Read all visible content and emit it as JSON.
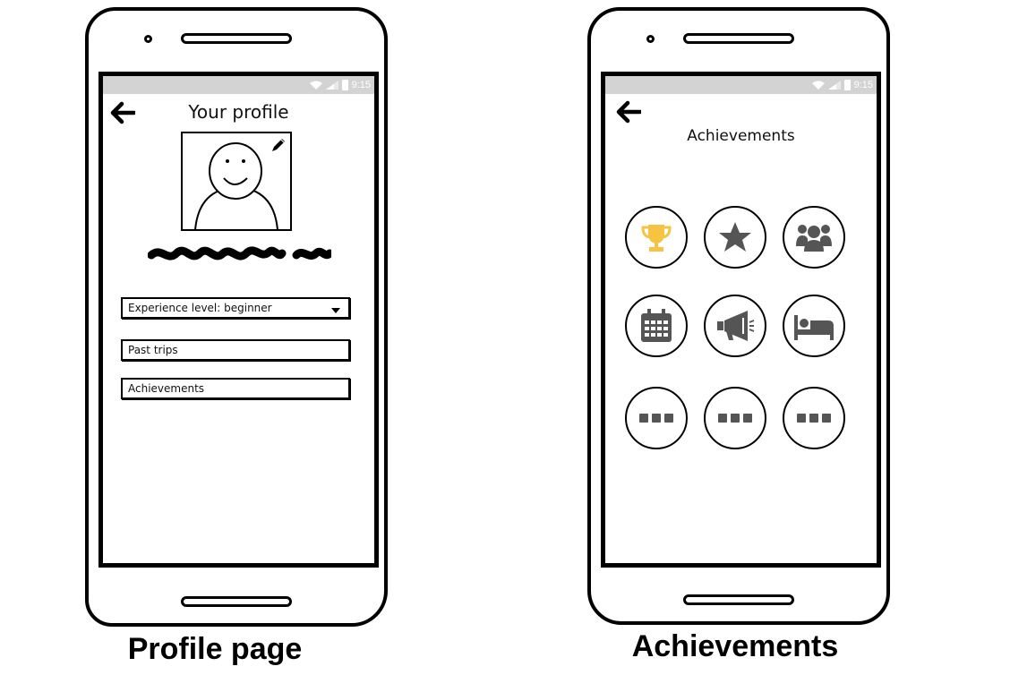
{
  "profile_screen": {
    "status_time": "9:15",
    "title": "Your profile",
    "experience_dropdown": {
      "selected": "Experience level: beginner"
    },
    "past_trips_label": "Past trips",
    "achievements_label": "Achievements",
    "caption": "Profile page"
  },
  "achievements_screen": {
    "status_time": "9:15",
    "title": "Achievements",
    "badges": [
      {
        "icon": "trophy-icon",
        "color": "#f6c343"
      },
      {
        "icon": "star-icon",
        "color": "#555555"
      },
      {
        "icon": "group-icon",
        "color": "#555555"
      },
      {
        "icon": "calendar-icon",
        "color": "#555555"
      },
      {
        "icon": "megaphone-icon",
        "color": "#555555"
      },
      {
        "icon": "bed-icon",
        "color": "#555555"
      },
      {
        "icon": "more-icon",
        "color": "#555555"
      },
      {
        "icon": "more-icon",
        "color": "#555555"
      },
      {
        "icon": "more-icon",
        "color": "#555555"
      }
    ],
    "caption": "Achievements"
  },
  "colors": {
    "statusbar": "#d3d3d3",
    "trophy": "#f6c343",
    "icon_gray": "#555555"
  }
}
